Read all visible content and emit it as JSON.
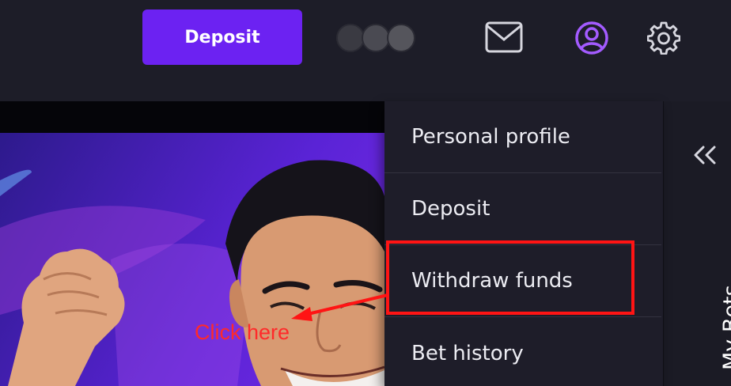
{
  "header": {
    "deposit_label": "Deposit",
    "icons": [
      "mail-icon",
      "user-icon",
      "gear-icon"
    ]
  },
  "dropdown": {
    "items": [
      {
        "label": "Personal profile"
      },
      {
        "label": "Deposit"
      },
      {
        "label": "Withdraw funds"
      },
      {
        "label": "Bet history"
      }
    ]
  },
  "sidebar": {
    "label": "My Bets",
    "icon": "chevrons-left-icon"
  },
  "annotation": {
    "text": "Click here",
    "color": "#ff1414"
  },
  "colors": {
    "accent": "#6c22f2",
    "user_icon": "#a35bff",
    "background": "#1d1d28"
  }
}
